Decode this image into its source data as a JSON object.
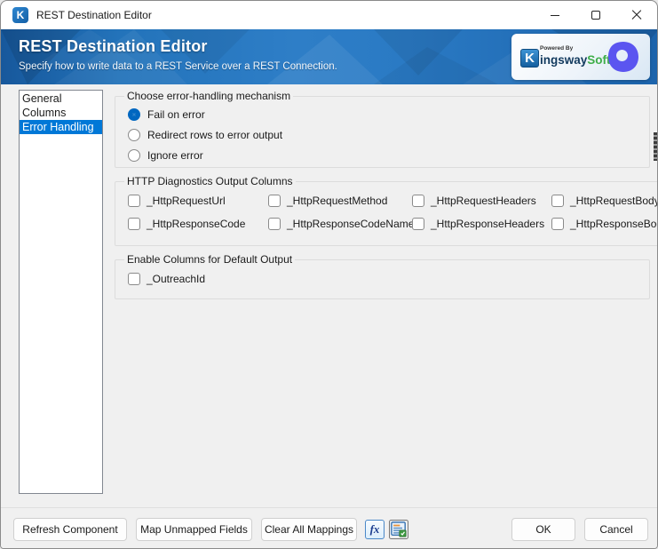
{
  "window": {
    "title": "REST Destination Editor",
    "app_icon_letter": "K"
  },
  "header": {
    "title": "REST Destination Editor",
    "subtitle": "Specify how to write data to a REST Service over a REST Connection.",
    "brand": {
      "powered_by": "Powered By",
      "k_letter": "K",
      "name_rest": "ingsway",
      "name_soft": "Soft"
    }
  },
  "sidebar": {
    "items": [
      {
        "label": "General",
        "selected": false
      },
      {
        "label": "Columns",
        "selected": false
      },
      {
        "label": "Error Handling",
        "selected": true
      }
    ]
  },
  "groups": {
    "error_handling": {
      "title": "Choose error-handling mechanism",
      "options": [
        {
          "label": "Fail on error",
          "selected": true
        },
        {
          "label": "Redirect rows to error output",
          "selected": false
        },
        {
          "label": "Ignore error",
          "selected": false
        }
      ]
    },
    "http_diagnostics": {
      "title": "HTTP Diagnostics Output Columns",
      "row1": [
        "_HttpRequestUrl",
        "_HttpRequestMethod",
        "_HttpRequestHeaders",
        "_HttpRequestBody"
      ],
      "row1_checked": [
        false,
        false,
        false,
        false
      ],
      "row2": [
        "_HttpResponseCode",
        "_HttpResponseCodeName",
        "_HttpResponseHeaders",
        "_HttpResponseBody"
      ],
      "row2_checked": [
        false,
        false,
        false,
        false
      ]
    },
    "default_output": {
      "title": "Enable Columns for Default Output",
      "checkboxes": [
        "_OutreachId"
      ],
      "checked": [
        false
      ]
    }
  },
  "footer": {
    "refresh_label": "Refresh Component",
    "map_label": "Map Unmapped Fields",
    "clear_label": "Clear All Mappings",
    "fx_label": "fx",
    "ok_label": "OK",
    "cancel_label": "Cancel"
  },
  "colors": {
    "header_blue": "#2373ba",
    "selection_blue": "#0078d7",
    "radio_checked_blue": "#0067c0",
    "brand_green": "#3fae49",
    "brand_navy": "#123a5e",
    "outreach_purple": "#5b55f0"
  }
}
